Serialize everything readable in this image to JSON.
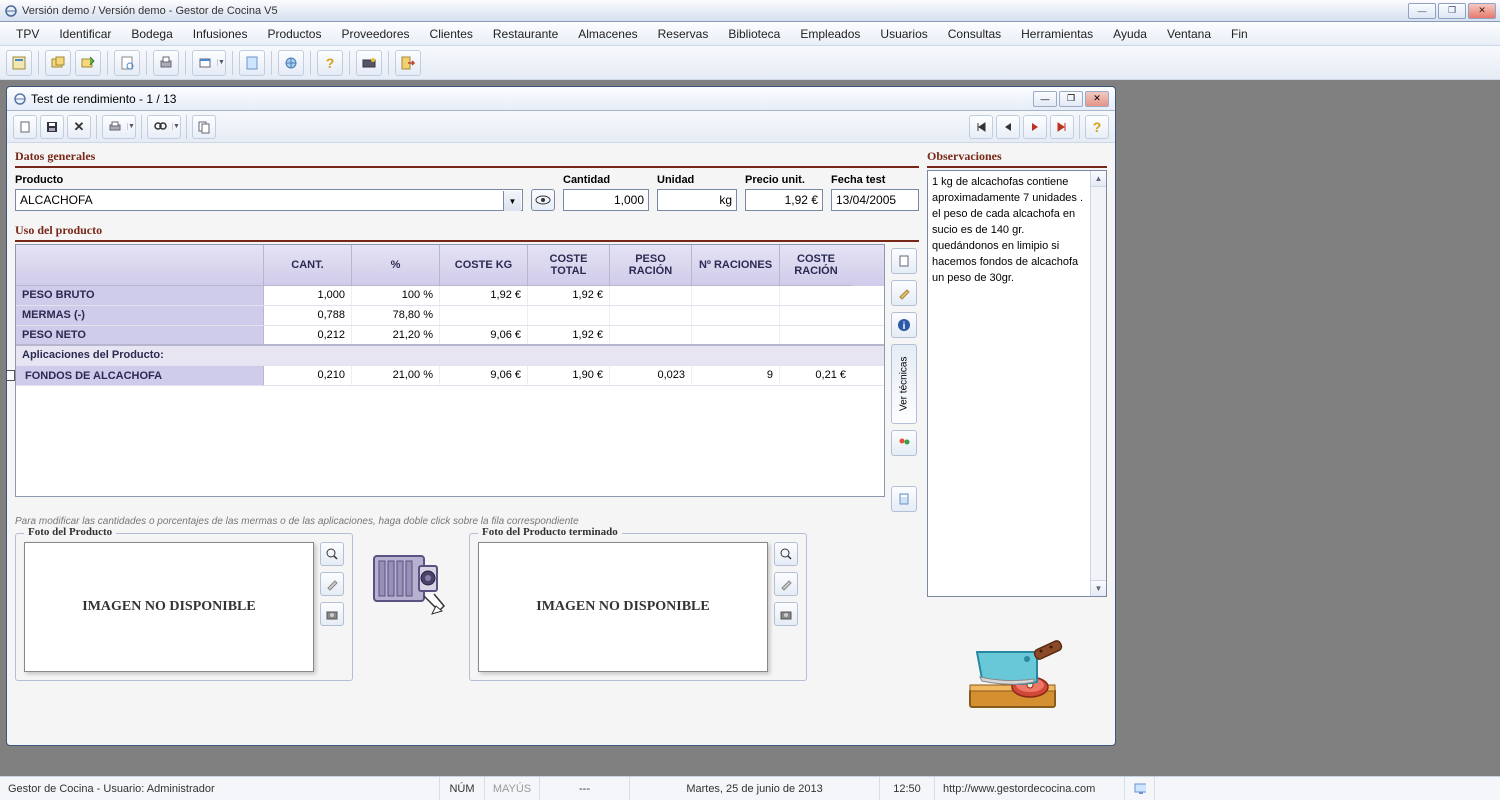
{
  "titlebar": {
    "text": "Versión demo / Versión demo - Gestor de Cocina V5"
  },
  "menus": [
    "TPV",
    "Identificar",
    "Bodega",
    "Infusiones",
    "Productos",
    "Proveedores",
    "Clientes",
    "Restaurante",
    "Almacenes",
    "Reservas",
    "Biblioteca",
    "Empleados",
    "Usuarios",
    "Consultas",
    "Herramientas",
    "Ayuda",
    "Ventana",
    "Fin"
  ],
  "child": {
    "title": "Test de rendimiento - 1 / 13"
  },
  "sections": {
    "datos_generales": "Datos generales",
    "uso_producto": "Uso del producto",
    "observaciones": "Observaciones",
    "foto_producto": "Foto del Producto",
    "foto_terminado": "Foto del Producto terminado"
  },
  "dg": {
    "producto_label": "Producto",
    "producto_value": "ALCACHOFA",
    "cantidad_label": "Cantidad",
    "cantidad_value": "1,000",
    "unidad_label": "Unidad",
    "unidad_value": "kg",
    "precio_label": "Precio unit.",
    "precio_value": "1,92 €",
    "fecha_label": "Fecha test",
    "fecha_value": "13/04/2005"
  },
  "grid": {
    "headers": {
      "cant": "CANT.",
      "pct": "%",
      "coste_kg": "COSTE KG",
      "coste_total": "COSTE TOTAL",
      "peso_racion": "PESO RACIÓN",
      "n_raciones": "Nº RACIONES",
      "coste_racion": "COSTE RACIÓN"
    },
    "row_labels": {
      "peso_bruto": "PESO BRUTO",
      "mermas": "MERMAS (-)",
      "peso_neto": "PESO NETO",
      "aplicaciones": "Aplicaciones del Producto:",
      "fondos": "FONDOS DE ALCACHOFA"
    },
    "cells": {
      "bruto": {
        "cant": "1,000",
        "pct": "100 %",
        "ckg": "1,92 €",
        "ctot": "1,92 €"
      },
      "mermas": {
        "cant": "0,788",
        "pct": "78,80 %"
      },
      "neto": {
        "cant": "0,212",
        "pct": "21,20 %",
        "ckg": "9,06 €",
        "ctot": "1,92 €"
      },
      "fondos": {
        "cant": "0,210",
        "pct": "21,00 %",
        "ckg": "9,06 €",
        "ctot": "1,90 €",
        "prac": "0,023",
        "nrac": "9",
        "crac": "0,21 €"
      }
    }
  },
  "hint": "Para modificar las cantidades o porcentajes de las mermas o de las aplicaciones, haga doble click sobre la fila correspondiente",
  "no_image": "IMAGEN NO DISPONIBLE",
  "side": {
    "ver_tecnicas": "Ver técnicas"
  },
  "obs_text": "1 kg de alcachofas contiene aproximadamente 7 unidades . el peso de cada alcachofa en sucio es de  140 gr. quedándonos en limipio  si hacemos fondos de alcachofa un peso de 30gr.",
  "status": {
    "user": "Gestor de Cocina - Usuario: Administrador",
    "num": "NÚM",
    "mayus": "MAYÚS",
    "dash": "---",
    "date": "Martes, 25 de junio de 2013",
    "time": "12:50",
    "url": "http://www.gestordecocina.com"
  }
}
